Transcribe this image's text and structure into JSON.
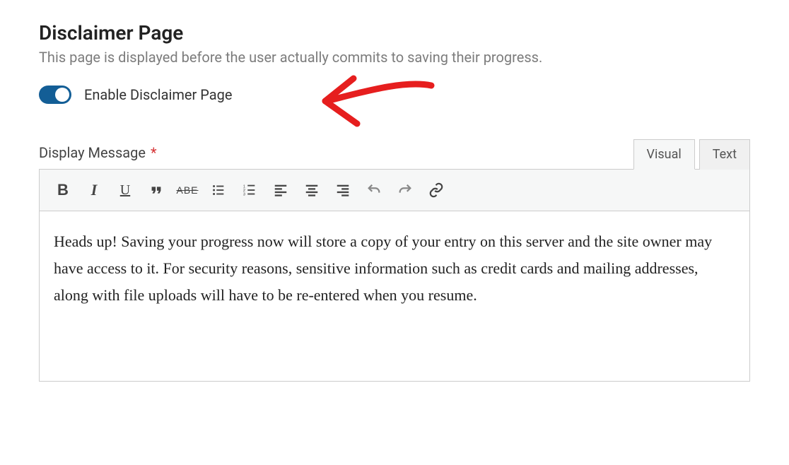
{
  "section": {
    "title": "Disclaimer Page",
    "description": "This page is displayed before the user actually commits to saving their progress."
  },
  "toggle": {
    "label": "Enable Disclaimer Page",
    "enabled": true
  },
  "field": {
    "label": "Display Message",
    "required_mark": "*"
  },
  "tabs": {
    "visual": "Visual",
    "text": "Text",
    "active": "visual"
  },
  "toolbar": {
    "bold": "B",
    "italic": "I",
    "underline": "U",
    "quote": "❝",
    "strike": "ABE"
  },
  "content": {
    "body": "Heads up! Saving your progress now will store a copy of your entry on this server and the site owner may have access to it. For security reasons, sensitive information such as credit cards and mailing addresses, along with file uploads will have to be re-entered when you resume."
  },
  "annotation": {
    "color": "#e61e1e"
  }
}
